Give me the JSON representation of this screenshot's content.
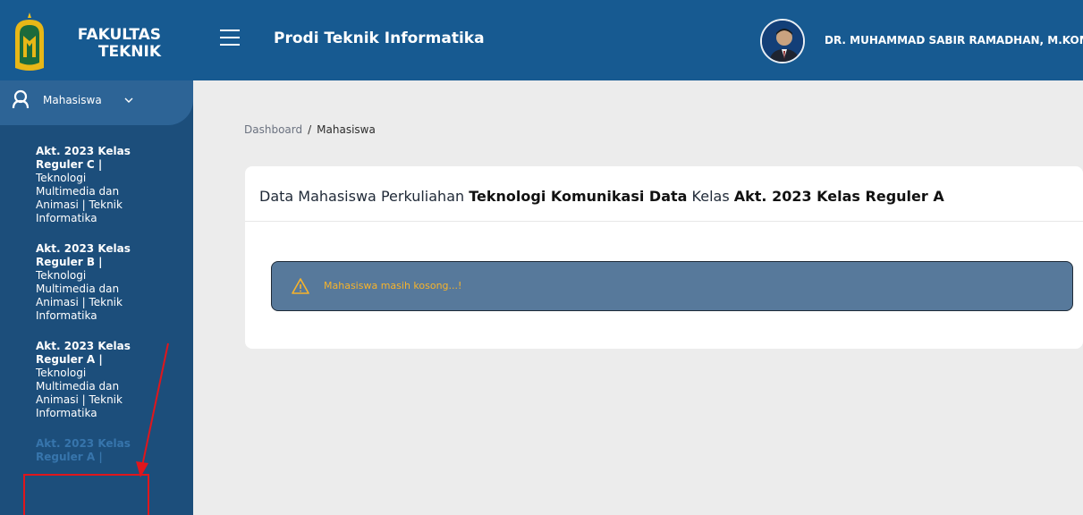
{
  "header": {
    "brand_line1": "FAKULTAS",
    "brand_line2": "TEKNIK",
    "app_title": "Prodi Teknik Informatika",
    "user_name": "DR. MUHAMMAD SABIR RAMADHAN, M.KOM.",
    "menu_icon": "hamburger-icon",
    "logo_icon": "faculty-logo-icon",
    "avatar_icon": "user-avatar"
  },
  "sidebar": {
    "role_label": "Mahasiswa",
    "role_icon": "user-icon",
    "chevron_icon": "chevron-down-icon",
    "classes": [
      {
        "title": "Akt. 2023 Kelas Reguler C |",
        "subtitle": "Teknologi Multimedia dan Animasi | Teknik Informatika"
      },
      {
        "title": "Akt. 2023 Kelas Reguler B |",
        "subtitle": "Teknologi Multimedia dan Animasi | Teknik Informatika"
      },
      {
        "title": "Akt. 2023 Kelas Reguler A |",
        "subtitle": "Teknologi Multimedia dan Animasi | Teknik Informatika"
      },
      {
        "title": "Akt. 2023 Kelas Reguler A |",
        "subtitle": ""
      }
    ]
  },
  "breadcrumb": {
    "home": "Dashboard",
    "separator": "/",
    "current": "Mahasiswa"
  },
  "card": {
    "title_prefix": "Data Mahasiswa Perkuliahan ",
    "course": "Teknologi Komunikasi Data",
    "title_mid": " Kelas ",
    "class_name": "Akt. 2023 Kelas Reguler A"
  },
  "alert": {
    "icon": "warning-icon",
    "message": "Mahasiswa masih kosong...!"
  },
  "colors": {
    "header": "#175a91",
    "sidebar": "#1c4e7b",
    "alert_bg": "#57799b",
    "alert_text": "#f7b32b",
    "annotation": "#e0161c"
  }
}
